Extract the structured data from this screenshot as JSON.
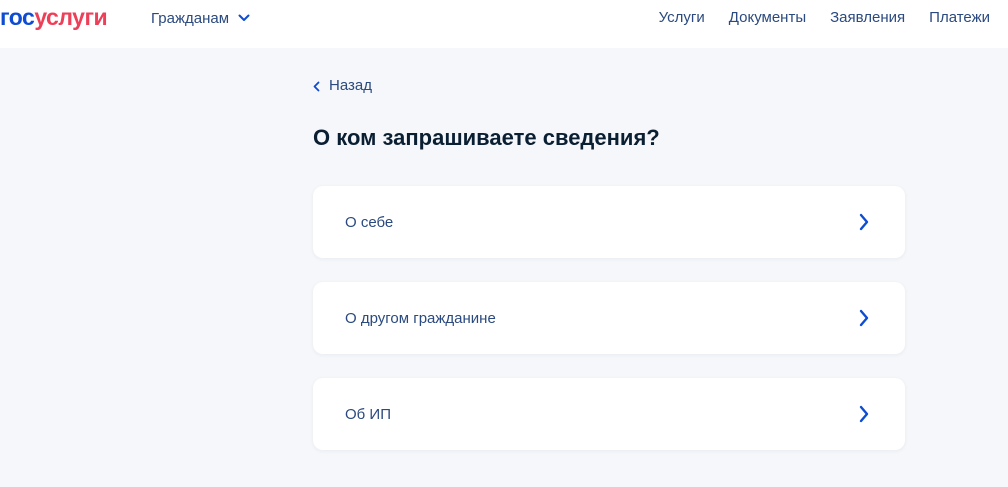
{
  "header": {
    "logo_part1": "гос",
    "logo_part2": "услуги",
    "audience_selector": "Гражданам",
    "nav": [
      "Услуги",
      "Документы",
      "Заявления",
      "Платежи"
    ]
  },
  "back_label": "Назад",
  "page_title": "О ком запрашиваете сведения?",
  "options": [
    {
      "label": "О себе"
    },
    {
      "label": "О другом гражданине"
    },
    {
      "label": "Об ИП"
    }
  ],
  "colors": {
    "brand_blue": "#0d4cd3",
    "brand_red": "#ee3f58",
    "link": "#2b4a7f",
    "title": "#0b1f33",
    "background": "#f5f7fa"
  },
  "icons": {
    "audience_chevron": "chevron-down-icon",
    "back": "chevron-left-icon",
    "option": "chevron-right-icon"
  }
}
